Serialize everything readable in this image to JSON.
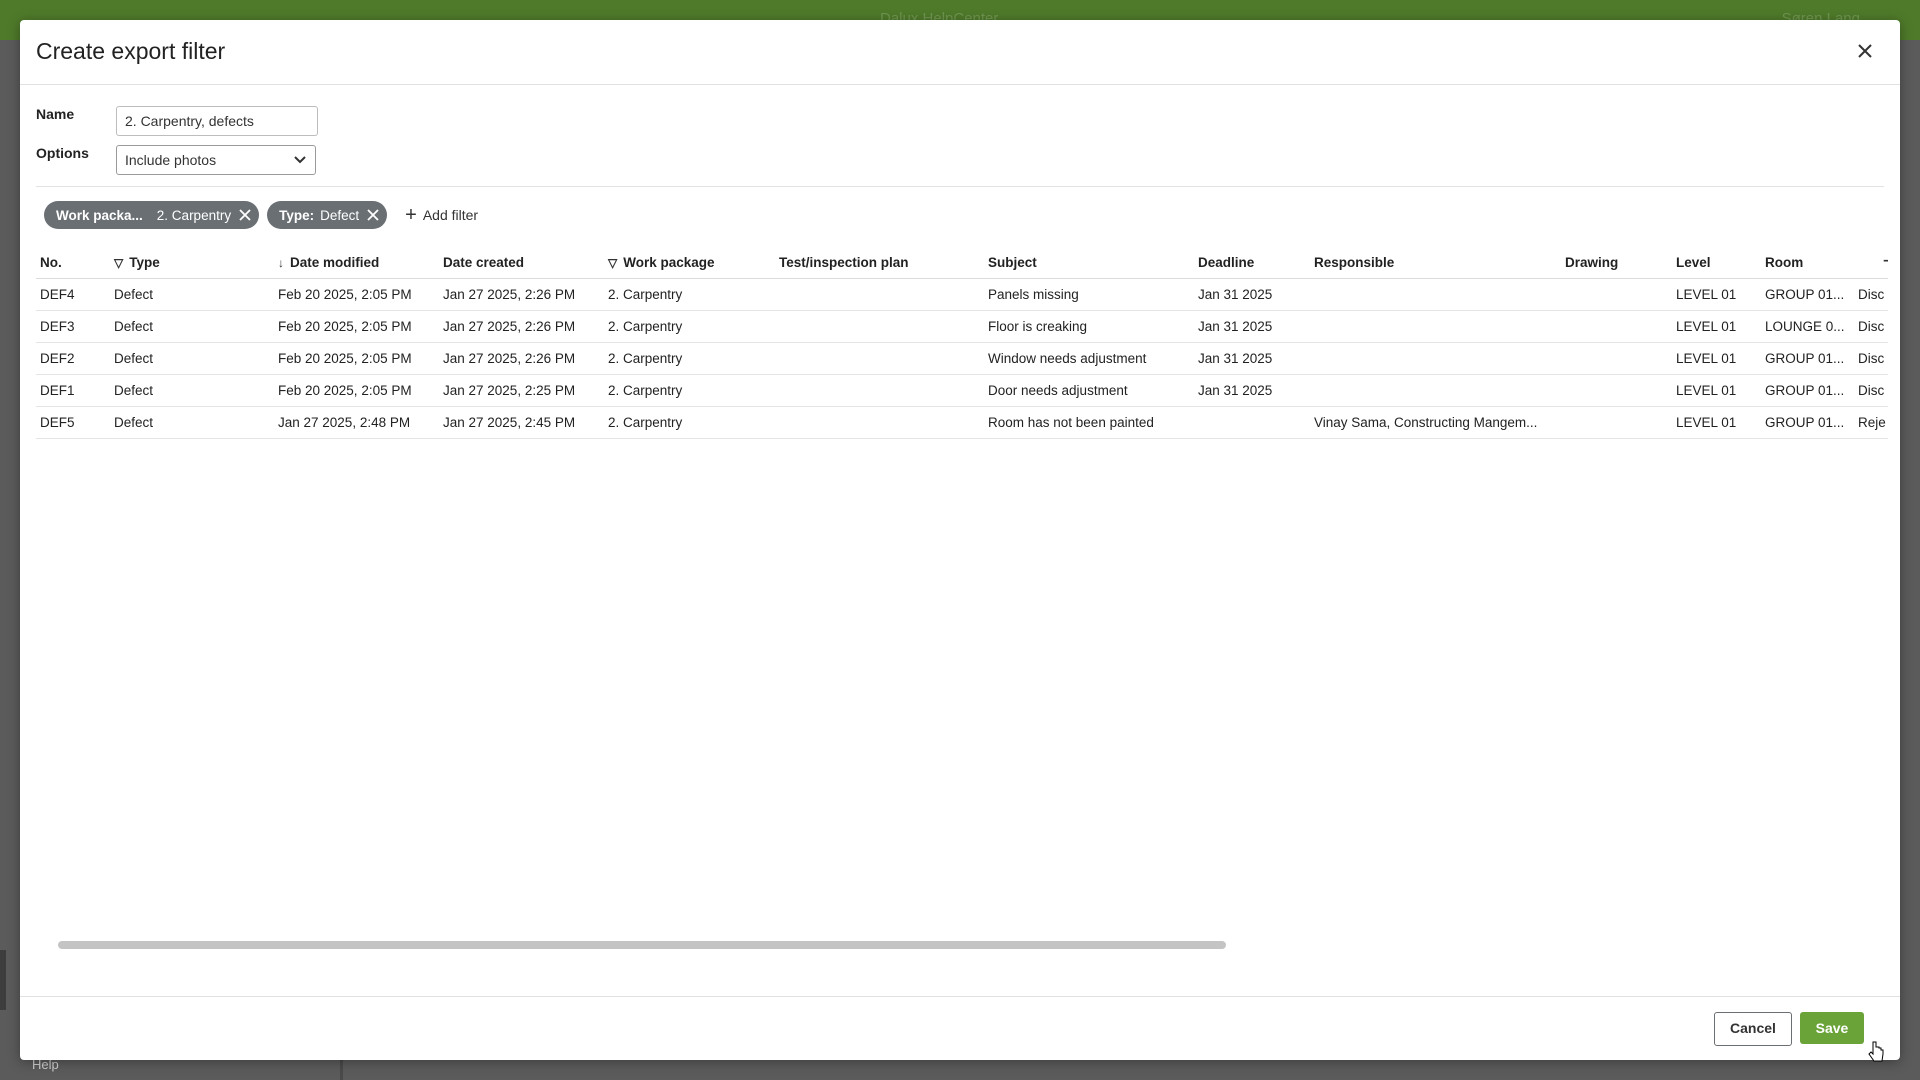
{
  "backdrop": {
    "app_title": "Dalux HelpCenter",
    "user_name": "Søren Lang",
    "help_label": "Help"
  },
  "modal": {
    "title": "Create export filter",
    "close_icon": "close-icon"
  },
  "form": {
    "name_label": "Name",
    "name_value": "2. Carpentry, defects",
    "options_label": "Options",
    "options_value": "Include photos"
  },
  "filters": {
    "chips": [
      {
        "key": "Work packa...",
        "value": "2. Carpentry"
      },
      {
        "key": "Type:",
        "value": "Defect"
      }
    ],
    "add_filter_label": "Add filter"
  },
  "table": {
    "columns": [
      "No.",
      "Type",
      "Date modified",
      "Date created",
      "Work package",
      "Test/inspection plan",
      "Subject",
      "Deadline",
      "Responsible",
      "Drawing",
      "Level",
      "Room",
      ""
    ],
    "rows": [
      [
        "DEF4",
        "Defect",
        "Feb 20 2025, 2:05 PM",
        "Jan 27 2025, 2:26 PM",
        "2. Carpentry",
        "",
        "Panels missing",
        "Jan 31 2025",
        "",
        "",
        "LEVEL 01",
        "GROUP 01...",
        "Disc"
      ],
      [
        "DEF3",
        "Defect",
        "Feb 20 2025, 2:05 PM",
        "Jan 27 2025, 2:26 PM",
        "2. Carpentry",
        "",
        "Floor is creaking",
        "Jan 31 2025",
        "",
        "",
        "LEVEL 01",
        "LOUNGE 0...",
        "Disc"
      ],
      [
        "DEF2",
        "Defect",
        "Feb 20 2025, 2:05 PM",
        "Jan 27 2025, 2:26 PM",
        "2. Carpentry",
        "",
        "Window needs adjustment",
        "Jan 31 2025",
        "",
        "",
        "LEVEL 01",
        "GROUP 01...",
        "Disc"
      ],
      [
        "DEF1",
        "Defect",
        "Feb 20 2025, 2:05 PM",
        "Jan 27 2025, 2:25 PM",
        "2. Carpentry",
        "",
        "Door needs adjustment",
        "Jan 31 2025",
        "",
        "",
        "LEVEL 01",
        "GROUP 01...",
        "Disc"
      ],
      [
        "DEF5",
        "Defect",
        "Jan 27 2025, 2:48 PM",
        "Jan 27 2025, 2:45 PM",
        "2. Carpentry",
        "",
        "Room has not been painted",
        "",
        "Vinay Sama, Constructing Mangem...",
        "",
        "LEVEL 01",
        "GROUP 01...",
        "Reje"
      ]
    ]
  },
  "footer": {
    "cancel_label": "Cancel",
    "save_label": "Save"
  },
  "colors": {
    "topbar": "#4f7a2a",
    "chip_bg": "#6a6f74",
    "save_bg": "#6aa338"
  }
}
